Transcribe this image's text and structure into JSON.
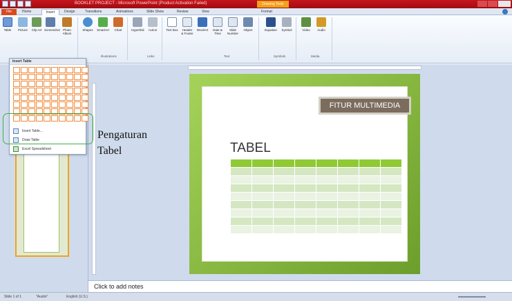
{
  "window": {
    "title": "BOOKLET PROJECT - Microsoft PowerPoint (Product Activation Failed)",
    "contextual_tab": "Drawing Tools"
  },
  "tabs": [
    "File",
    "Home",
    "Insert",
    "Design",
    "Transitions",
    "Animations",
    "Slide Show",
    "Review",
    "View",
    "Format"
  ],
  "active_tab": "Insert",
  "ribbon": {
    "buttons": [
      {
        "label": "Table",
        "icon": "table-icon"
      },
      {
        "label": "Picture",
        "icon": "picture-icon"
      },
      {
        "label": "Clip Art",
        "icon": "clipart-icon"
      },
      {
        "label": "Screenshot",
        "icon": "screenshot-icon"
      },
      {
        "label": "Photo Album",
        "icon": "photo-album-icon"
      },
      {
        "label": "Shapes",
        "icon": "shapes-icon"
      },
      {
        "label": "SmartArt",
        "icon": "smartart-icon"
      },
      {
        "label": "Chart",
        "icon": "chart-icon"
      },
      {
        "label": "Hyperlink",
        "icon": "hyperlink-icon"
      },
      {
        "label": "Action",
        "icon": "action-icon"
      },
      {
        "label": "Text Box",
        "icon": "textbox-icon"
      },
      {
        "label": "Header & Footer",
        "icon": "header-footer-icon"
      },
      {
        "label": "WordArt",
        "icon": "wordart-icon"
      },
      {
        "label": "Date & Time",
        "icon": "date-time-icon"
      },
      {
        "label": "Slide Number",
        "icon": "slide-number-icon"
      },
      {
        "label": "Object",
        "icon": "object-icon"
      },
      {
        "label": "Equation",
        "icon": "equation-icon"
      },
      {
        "label": "Symbol",
        "icon": "symbol-icon"
      },
      {
        "label": "Video",
        "icon": "video-icon"
      },
      {
        "label": "Audio",
        "icon": "audio-icon"
      }
    ],
    "groups": [
      "Illustrations",
      "Links",
      "Text",
      "Symbols",
      "Media"
    ]
  },
  "table_dropdown": {
    "header": "Insert Table",
    "items": [
      "Insert Table...",
      "Draw Table",
      "Excel Spreadsheet"
    ]
  },
  "annotation": {
    "line1": "Pengaturan",
    "line2": "Tabel"
  },
  "slide": {
    "tag": "FITUR MULTIMEDIA",
    "title": "TABEL"
  },
  "notes": {
    "placeholder": "Click to add notes"
  },
  "status": {
    "slide": "Slide 1 of 1",
    "theme": "\"Austin\"",
    "language": "English (U.S.)"
  }
}
